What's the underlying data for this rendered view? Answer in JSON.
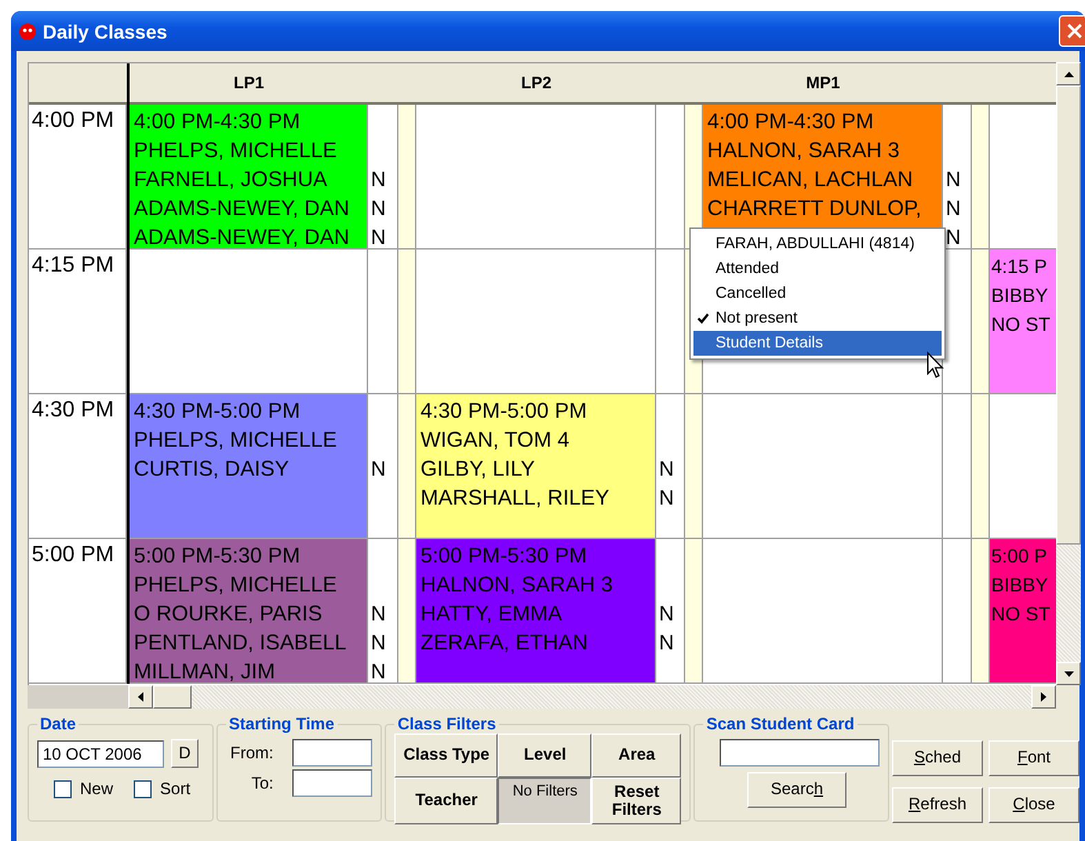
{
  "window": {
    "title": "Daily Classes"
  },
  "grid": {
    "columns": [
      {
        "heading": "LP1"
      },
      {
        "heading": "LP2"
      },
      {
        "heading": "MP1"
      },
      {}
    ],
    "rows": [
      {
        "time": "4:00 PM",
        "cells": [
          {
            "color": "#00ff00",
            "lines": [
              {
                "text": "4:00 PM-4:30 PM"
              },
              {
                "text": "PHELPS, MICHELLE"
              },
              {
                "text": "FARNELL, JOSHUA",
                "status": "N"
              },
              {
                "text": "ADAMS-NEWEY, DAN",
                "status": "N"
              },
              {
                "text": "ADAMS-NEWEY, DAN",
                "status": "N"
              }
            ]
          },
          null,
          {
            "color": "#ff8000",
            "lines": [
              {
                "text": "4:00 PM-4:30 PM"
              },
              {
                "text": "HALNON, SARAH 3"
              },
              {
                "text": "MELICAN, LACHLAN",
                "status": "N"
              },
              {
                "text": "CHARRETT DUNLOP,",
                "status": "N"
              },
              {
                "status": "N"
              }
            ]
          },
          null
        ]
      },
      {
        "time": "4:15 PM",
        "cells": [
          null,
          null,
          null,
          {
            "color": "#ff80ff",
            "lines": [
              {
                "text": "4:15 P"
              },
              {
                "text": "BIBBY"
              },
              {
                "text": "NO ST"
              }
            ]
          }
        ]
      },
      {
        "time": "4:30 PM",
        "cells": [
          {
            "color": "#8080ff",
            "lines": [
              {
                "text": "4:30 PM-5:00 PM"
              },
              {
                "text": "PHELPS, MICHELLE"
              },
              {
                "text": "CURTIS, DAISY",
                "status": "N"
              }
            ]
          },
          {
            "color": "#ffff80",
            "lines": [
              {
                "text": "4:30 PM-5:00 PM"
              },
              {
                "text": "WIGAN, TOM 4"
              },
              {
                "text": "GILBY, LILY",
                "status": "N"
              },
              {
                "text": "MARSHALL, RILEY",
                "status": "N"
              }
            ]
          },
          null,
          null
        ]
      },
      {
        "time": "5:00 PM",
        "cells": [
          {
            "color": "#9c5c9c",
            "lines": [
              {
                "text": "5:00 PM-5:30 PM"
              },
              {
                "text": "PHELPS, MICHELLE"
              },
              {
                "text": "O ROURKE, PARIS",
                "status": "N"
              },
              {
                "text": "PENTLAND, ISABELL",
                "status": "N"
              },
              {
                "text": "MILLMAN, JIM",
                "status": "N"
              }
            ]
          },
          {
            "color": "#8000ff",
            "lines": [
              {
                "text": "5:00 PM-5:30 PM"
              },
              {
                "text": "HALNON, SARAH 3"
              },
              {
                "text": "HATTY, EMMA",
                "status": "N"
              },
              {
                "text": "ZERAFA, ETHAN",
                "status": "N"
              }
            ]
          },
          null,
          {
            "color": "#ff0080",
            "lines": [
              {
                "text": "5:00 P"
              },
              {
                "text": "BIBBY"
              },
              {
                "text": "NO ST"
              }
            ]
          }
        ]
      }
    ]
  },
  "context_menu": {
    "items": [
      {
        "label": "FARAH, ABDULLAHI (4814)",
        "checked": false,
        "selected": false
      },
      {
        "label": "Attended",
        "checked": false,
        "selected": false
      },
      {
        "label": "Cancelled",
        "checked": false,
        "selected": false
      },
      {
        "label": "Not present",
        "checked": true,
        "selected": false
      },
      {
        "label": "Student Details",
        "checked": false,
        "selected": true
      }
    ]
  },
  "date": {
    "legend": "Date",
    "value": "10 OCT 2006",
    "picker": "D",
    "checkboxes": [
      {
        "label": "New",
        "checked": false
      },
      {
        "label": "Sort",
        "checked": false
      }
    ]
  },
  "starting_time": {
    "legend": "Starting Time",
    "fields": [
      {
        "label": "From:"
      },
      {
        "label": "To:"
      }
    ]
  },
  "class_filters": {
    "legend": "Class Filters",
    "buttons": [
      {
        "label": "Class Type",
        "pressed": false
      },
      {
        "label": "Level",
        "pressed": false
      },
      {
        "label": "Area",
        "pressed": false
      },
      {
        "label": "Teacher",
        "pressed": false
      },
      {
        "label": "No Filters",
        "pressed": true
      },
      {
        "label": "Reset Filters",
        "pressed": false
      }
    ]
  },
  "scan_student_card": {
    "legend": "Scan Student Card",
    "search": {
      "before": "Searc",
      "key": "h"
    }
  },
  "buttons": [
    {
      "key": "S",
      "after": "ched"
    },
    {
      "key": "F",
      "after": "ont"
    },
    {
      "key": "R",
      "after": "efresh"
    },
    {
      "key": "C",
      "after": "lose"
    }
  ]
}
